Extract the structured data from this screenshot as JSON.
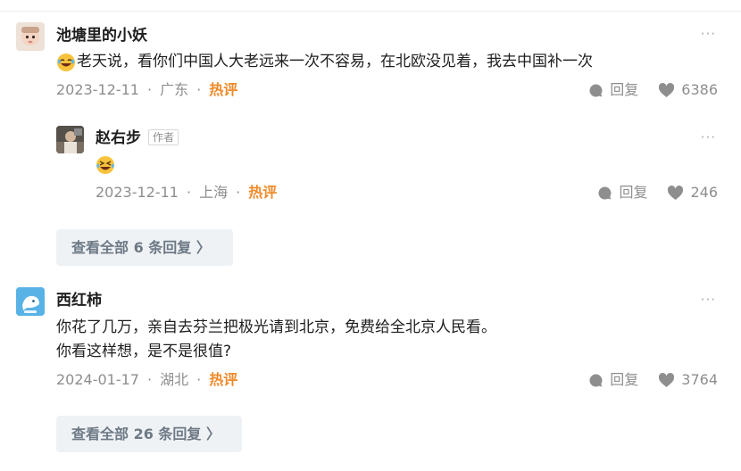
{
  "comments": [
    {
      "username": "池塘里的小妖",
      "text": "老天说，看你们中国人大老远来一次不容易，在北欧没见着，我去中国补一次",
      "date": "2023-12-11",
      "location": "广东",
      "hot_label": "热评",
      "reply_label": "回复",
      "likes": "6386",
      "more": "···",
      "sub_reply": {
        "username": "赵右步",
        "badge": "作者",
        "date": "2023-12-11",
        "location": "上海",
        "hot_label": "热评",
        "reply_label": "回复",
        "likes": "246",
        "more": "···"
      },
      "view_all": "查看全部 6 条回复 〉"
    },
    {
      "username": "西红柿",
      "text_lines": [
        "你花了几万，亲自去芬兰把极光请到北京，免费给全北京人民看。",
        "你看这样想，是不是很值?"
      ],
      "date": "2024-01-17",
      "location": "湖北",
      "hot_label": "热评",
      "reply_label": "回复",
      "likes": "3764",
      "more": "···",
      "view_all": "查看全部 26 条回复 〉"
    }
  ],
  "separator": "·",
  "colors": {
    "hot": "#f08a2a",
    "meta": "#8e8e8e",
    "reply_bg": "#eff2f5"
  },
  "icons": [
    "reply-bubble-icon",
    "heart-icon",
    "laughing-emoji-icon",
    "grinning-squint-emoji-icon"
  ]
}
